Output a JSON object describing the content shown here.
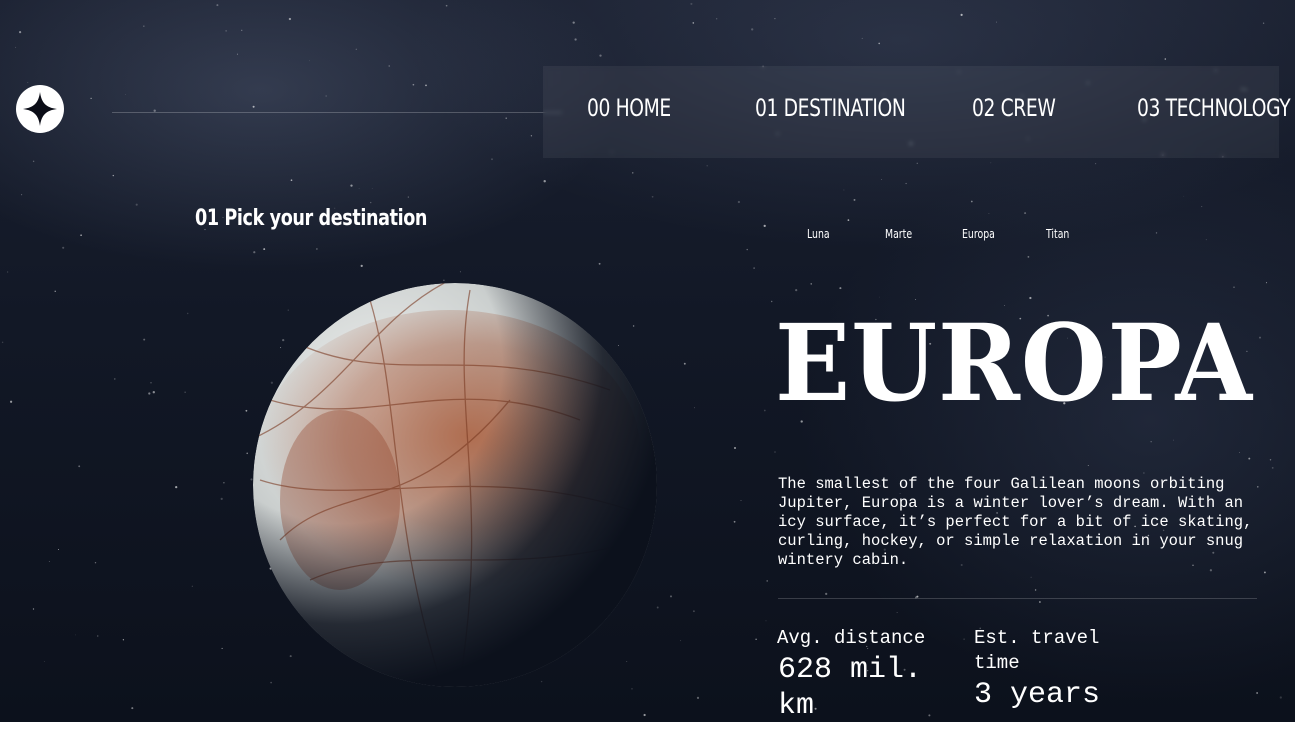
{
  "header": {
    "logo_icon": "four-point-star-icon",
    "nav": [
      {
        "label": "00 HOME"
      },
      {
        "label": "01 DESTINATION"
      },
      {
        "label": "02 CREW"
      },
      {
        "label": "03 TECHNOLOGY"
      }
    ]
  },
  "main": {
    "subheading": "01 Pick your destination",
    "tabs": [
      {
        "label": "Luna"
      },
      {
        "label": "Marte"
      },
      {
        "label": "Europa"
      },
      {
        "label": "Titan"
      }
    ],
    "planet_image": "europa-moon-image",
    "title": "EUROPA",
    "description": "The smallest of the four Galilean moons orbiting Jupiter, Europa is a winter lover’s dream. With an icy surface, it’s perfect for a bit of ice skating, curling, hockey, or simple relaxation in your snug wintery cabin.",
    "stats": {
      "distance_label": "Avg. distance",
      "distance_value": "628 mil. km",
      "travel_label": "Est. travel time",
      "travel_value": "3 years"
    }
  },
  "colors": {
    "background": "#121826",
    "text": "#ffffff",
    "planet_ice": "#d9dde0",
    "planet_rust": "#9a4a2a"
  }
}
